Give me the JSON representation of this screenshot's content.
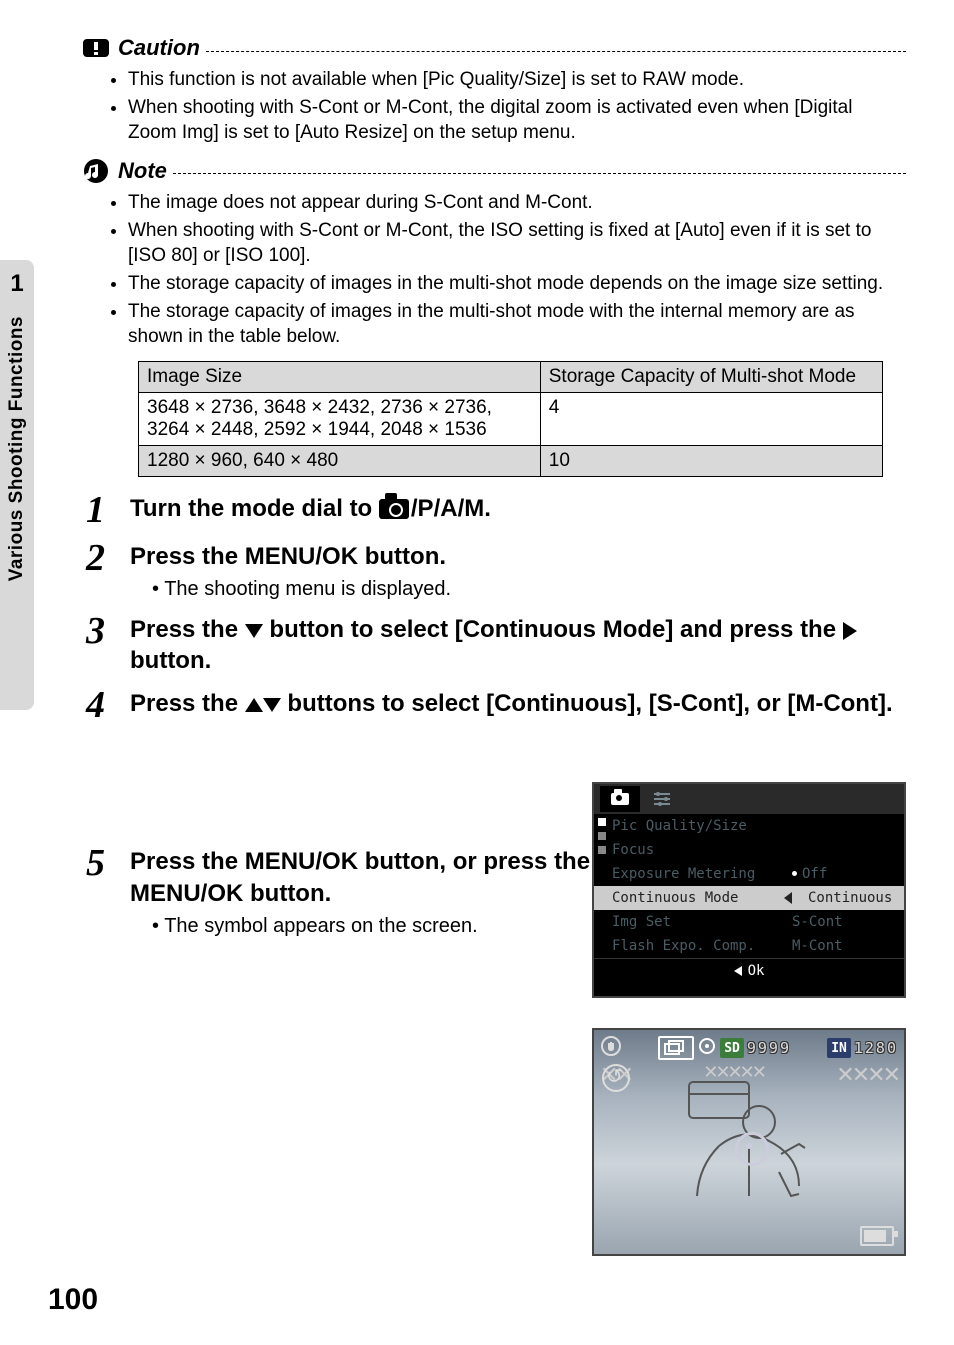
{
  "side_tab": {
    "chapter_num": "1",
    "chapter_title": "Various Shooting Functions"
  },
  "caution": {
    "heading": "Caution",
    "items": [
      "This function is not available when [Pic Quality/Size] is set to RAW mode.",
      "When shooting with S-Cont or M-Cont, the digital zoom is activated even when [Digital Zoom Img] is set to [Auto Resize] on the setup menu."
    ]
  },
  "note": {
    "heading": "Note",
    "items": [
      "The image does not appear during S-Cont and M-Cont.",
      "When shooting with S-Cont or M-Cont, the ISO setting is fixed at [Auto] even if it is set to [ISO 80] or [ISO 100].",
      "The storage capacity of images in the multi-shot mode depends on the image size setting.",
      "The storage capacity of images in the multi-shot mode with the internal memory are as shown in the table below."
    ]
  },
  "table": {
    "headers": [
      "Image Size",
      "Storage Capacity of Multi-shot Mode"
    ],
    "rows": [
      [
        "3648 × 2736, 3648 × 2432, 2736 × 2736, 3264 × 2448, 2592 × 1944, 2048 × 1536",
        "4"
      ],
      [
        "1280 × 960, 640 × 480",
        "10"
      ]
    ]
  },
  "steps": {
    "s1": {
      "n": "1",
      "pre": "Turn the mode dial to ",
      "post": "/P/A/M."
    },
    "s2": {
      "n": "2",
      "title": "Press the MENU/OK button.",
      "sub": "The shooting menu is displayed."
    },
    "s3": {
      "n": "3",
      "pre": "Press the ",
      "mid": " button to select [Continuous Mode] and press the ",
      "post": " button."
    },
    "s4": {
      "n": "4",
      "pre": "Press the ",
      "post": " buttons to select [Continuous], [S-Cont], or [M-Cont]."
    },
    "s5": {
      "n": "5",
      "pre": "Press the MENU/OK button, or press the ",
      "post": " button and then the MENU/OK button.",
      "sub": "The symbol appears on the screen."
    }
  },
  "lcd1": {
    "rows": [
      {
        "label": "Pic Quality/Size",
        "value": ""
      },
      {
        "label": "Focus",
        "value": ""
      },
      {
        "label": "Exposure Metering",
        "value": "Off",
        "bullet": true
      },
      {
        "label": "Continuous Mode",
        "value": "Continuous",
        "selected": true
      },
      {
        "label": "Img Set",
        "value": "S-Cont"
      },
      {
        "label": "Flash Expo. Comp.",
        "value": "M-Cont"
      }
    ],
    "footer": "Ok"
  },
  "lcd2": {
    "sd_label": "SD",
    "sd_count": "9999",
    "in_label": "IN",
    "in_size": "1280"
  },
  "page_number": "100"
}
